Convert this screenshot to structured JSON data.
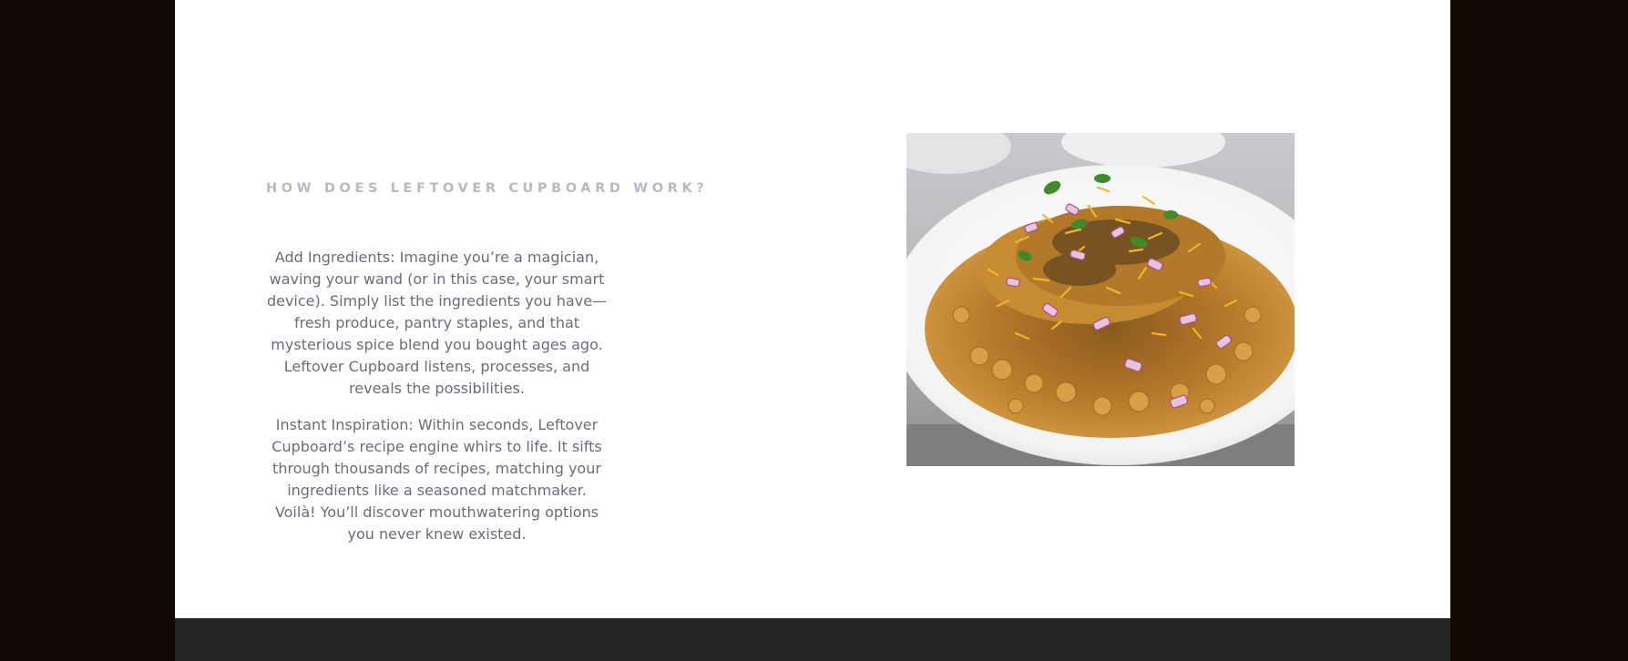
{
  "section": {
    "heading": "HOW DOES LEFTOVER CUPBOARD WORK?",
    "paragraphs": [
      "Add Ingredients: Imagine you’re a magician, waving your wand (or in this case, your smart device). Simply list the ingredients you have—fresh produce, pantry staples, and that mysterious spice blend you bought ages ago. Leftover Cupboard listens, processes, and reveals the possibilities.",
      "Instant Inspiration: Within seconds, Leftover Cupboard’s recipe engine whirs to life. It sifts through thousands of recipes, matching your ingredients like a seasoned matchmaker. Voilà! You’ll discover mouthwatering options you never knew existed."
    ]
  },
  "image": {
    "subject": "plate of chickpea curry topped with onions, sev and cilantro"
  },
  "colors": {
    "outer_background": "#120a05",
    "page_background": "#ffffff",
    "footer_band": "#262524",
    "heading_text": "#b9b9c3",
    "body_text": "#6b6b7e"
  }
}
